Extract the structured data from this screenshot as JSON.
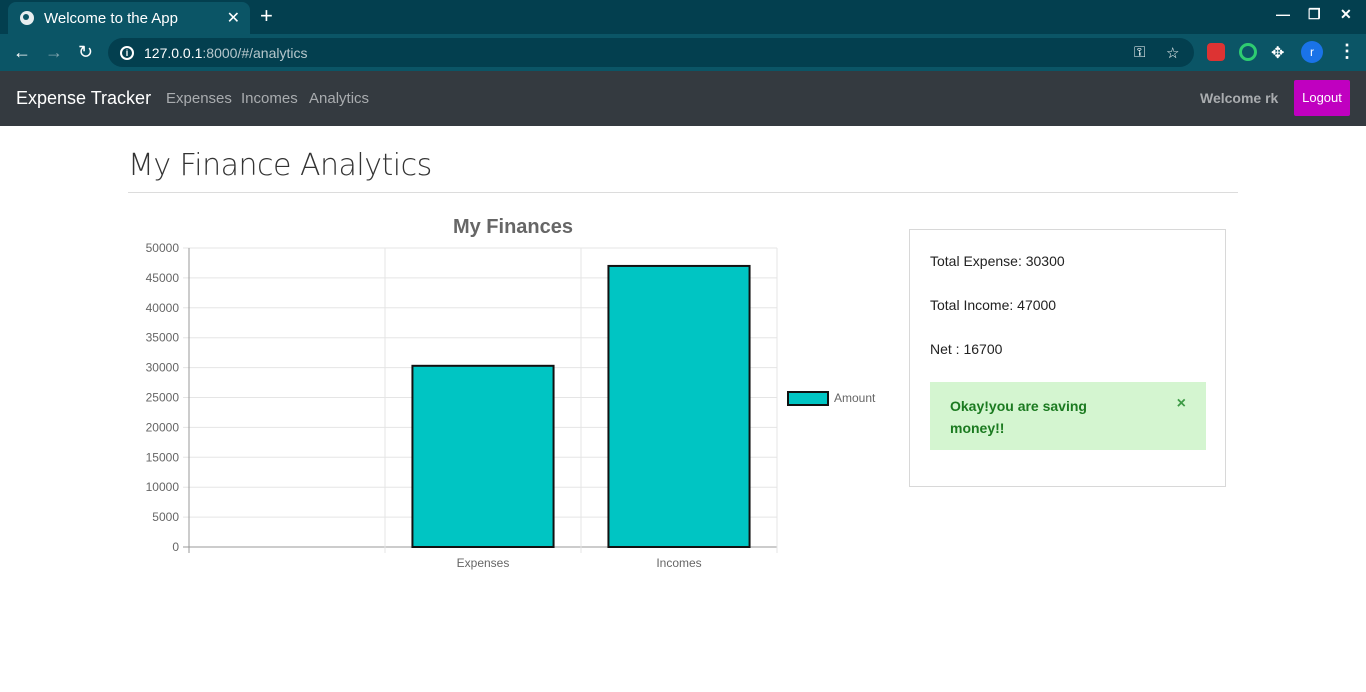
{
  "browser": {
    "tab_title": "Welcome to the App",
    "url_host": "127.0.0.1",
    "url_path": ":8000/#/analytics",
    "profile_initial": "r"
  },
  "navbar": {
    "brand": "Expense Tracker",
    "links": [
      "Expenses",
      "Incomes",
      "Analytics"
    ],
    "welcome": "Welcome rk",
    "logout_label": "Logout",
    "logout_color": "#c000c0"
  },
  "page": {
    "title": "My Finance Analytics"
  },
  "summary": {
    "total_expense": "Total Expense: 30300",
    "total_income": "Total Income: 47000",
    "net": "Net : 16700",
    "alert_text": "Okay!you are saving money!!",
    "alert_close": "×"
  },
  "chart_data": {
    "type": "bar",
    "title": "My Finances",
    "categories": [
      "",
      "Expenses",
      "Incomes"
    ],
    "series": [
      {
        "name": "Amount",
        "values": [
          null,
          30300,
          47000
        ],
        "color": "#00c5c3"
      }
    ],
    "ylim": [
      0,
      50000
    ],
    "yticks": [
      0,
      5000,
      10000,
      15000,
      20000,
      25000,
      30000,
      35000,
      40000,
      45000,
      50000
    ],
    "grid": true,
    "legend": "right",
    "xlabel": "",
    "ylabel": ""
  }
}
